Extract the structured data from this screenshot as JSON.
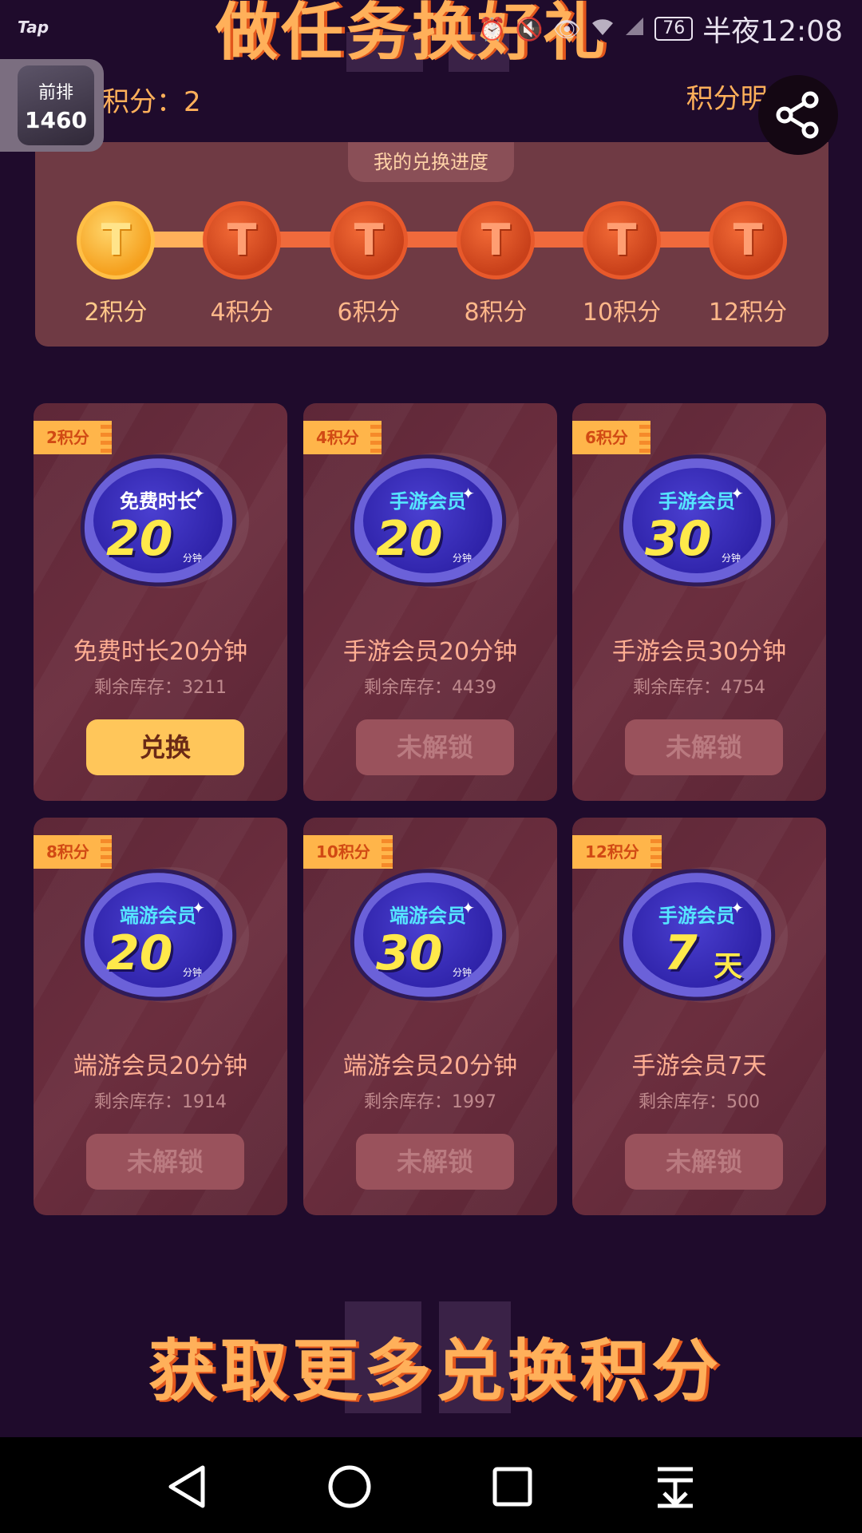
{
  "status_bar": {
    "app_logo": "Tap",
    "battery": "76",
    "clock": "半夜12:08",
    "icons": [
      "alarm-icon",
      "mute-icon",
      "eye-icon",
      "wifi-icon",
      "signal-icon"
    ]
  },
  "header": {
    "title": "做任务换好礼",
    "points": "积分：2",
    "points_detail": "积分明细 ›"
  },
  "floating_widget": {
    "label": "前排",
    "count": "1460"
  },
  "progress": {
    "title": "我的兑换进度",
    "steps": [
      {
        "label": "2积分",
        "state": "active"
      },
      {
        "label": "4积分",
        "state": "locked"
      },
      {
        "label": "6积分",
        "state": "locked"
      },
      {
        "label": "8积分",
        "state": "locked"
      },
      {
        "label": "10积分",
        "state": "locked"
      },
      {
        "label": "12积分",
        "state": "locked"
      }
    ]
  },
  "rewards": [
    {
      "tag": "2积分",
      "badge_top": "免费时长",
      "badge_num": "20",
      "badge_unit": "分钟",
      "title": "免费时长20分钟",
      "stock": "剩余库存：3211",
      "button": "兑换"
    },
    {
      "tag": "4积分",
      "badge_top": "手游会员",
      "badge_num": "20",
      "badge_unit": "分钟",
      "title": "手游会员20分钟",
      "stock": "剩余库存：4439",
      "button": "未解锁"
    },
    {
      "tag": "6积分",
      "badge_top": "手游会员",
      "badge_num": "30",
      "badge_unit": "分钟",
      "title": "手游会员30分钟",
      "stock": "剩余库存：4754",
      "button": "未解锁"
    },
    {
      "tag": "8积分",
      "badge_top": "端游会员",
      "badge_num": "20",
      "badge_unit": "分钟",
      "title": "端游会员20分钟",
      "stock": "剩余库存：1914",
      "button": "未解锁"
    },
    {
      "tag": "10积分",
      "badge_top": "端游会员",
      "badge_num": "30",
      "badge_unit": "分钟",
      "title": "端游会员20分钟",
      "stock": "剩余库存：1997",
      "button": "未解锁"
    },
    {
      "tag": "12积分",
      "badge_top": "手游会员",
      "badge_num": "7",
      "badge_unit": "天",
      "title": "手游会员7天",
      "stock": "剩余库存：500",
      "button": "未解锁"
    }
  ],
  "section": {
    "title": "获取更多兑换积分"
  },
  "colors": {
    "background": "#1f0b2c",
    "accent": "#ffb05a",
    "card": "#6b2e3e",
    "badge": "#6b61d9",
    "button_active": "#ffc65a",
    "button_locked": "#9a525c"
  }
}
